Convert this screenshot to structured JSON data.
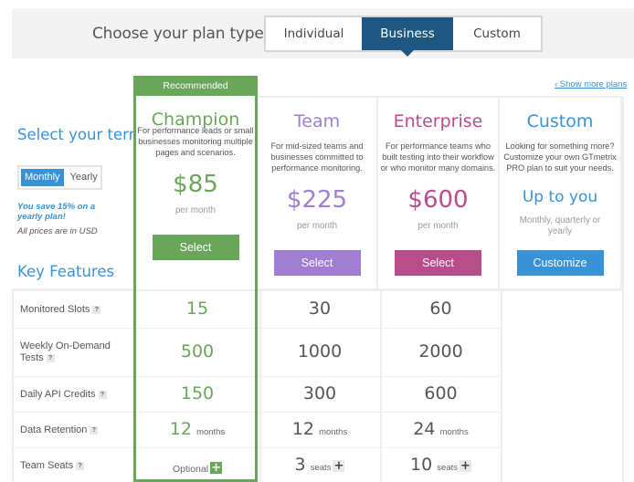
{
  "header": {
    "title": "Choose your plan type",
    "plan_types": [
      {
        "label": "Individual",
        "selected": false
      },
      {
        "label": "Business",
        "selected": true
      },
      {
        "label": "Custom",
        "selected": false
      }
    ]
  },
  "term": {
    "title": "Select your term",
    "options": [
      {
        "label": "Monthly",
        "selected": true
      },
      {
        "label": "Yearly",
        "selected": false
      }
    ],
    "save_note": "You save 15% on a yearly plan!",
    "currency_note": "All prices are in USD"
  },
  "show_more_link": "‹ Show more plans",
  "key_features_title": "Key Features",
  "colors": {
    "champion": "#6aa659",
    "team": "#a07ed1",
    "enterprise": "#b84d8a",
    "custom": "#3a92d6",
    "header_active": "#1e5882"
  },
  "plans": [
    {
      "name": "Champion",
      "badge": "Recommended",
      "description": "For performance leads or small businesses monitoring multiple pages and scenarios.",
      "price": "$85",
      "period": "per month",
      "button": "Select"
    },
    {
      "name": "Team",
      "description": "For mid-sized teams and businesses committed to performance monitoring.",
      "price": "$225",
      "period": "per month",
      "button": "Select"
    },
    {
      "name": "Enterprise",
      "description": "For performance teams who built testing into their workflow or who monitor many domains.",
      "price": "$600",
      "period": "per month",
      "button": "Select"
    },
    {
      "name": "Custom",
      "description": "Looking for something more? Customize your own GTmetrix PRO plan to suit your needs.",
      "price": "Up to you",
      "period": "Monthly, quarterly or yearly",
      "button": "Customize"
    }
  ],
  "features": [
    {
      "label": "Monitored Slots",
      "help": "?",
      "values": [
        {
          "num": "15",
          "unit": ""
        },
        {
          "num": "30",
          "unit": ""
        },
        {
          "num": "60",
          "unit": ""
        }
      ]
    },
    {
      "label": "Weekly On-Demand Tests",
      "help": "?",
      "values": [
        {
          "num": "500",
          "unit": ""
        },
        {
          "num": "1000",
          "unit": ""
        },
        {
          "num": "2000",
          "unit": ""
        }
      ]
    },
    {
      "label": "Daily API Credits",
      "help": "?",
      "values": [
        {
          "num": "150",
          "unit": ""
        },
        {
          "num": "300",
          "unit": ""
        },
        {
          "num": "600",
          "unit": ""
        }
      ]
    },
    {
      "label": "Data Retention",
      "help": "?",
      "values": [
        {
          "num": "12",
          "unit": "months"
        },
        {
          "num": "12",
          "unit": "months"
        },
        {
          "num": "24",
          "unit": "months"
        }
      ]
    },
    {
      "label": "Team Seats",
      "help": "?",
      "values": [
        {
          "num": "",
          "unit": "Optional",
          "add": "+"
        },
        {
          "num": "3",
          "unit": "seats",
          "add": "+"
        },
        {
          "num": "10",
          "unit": "seats",
          "add": "+"
        }
      ]
    }
  ]
}
